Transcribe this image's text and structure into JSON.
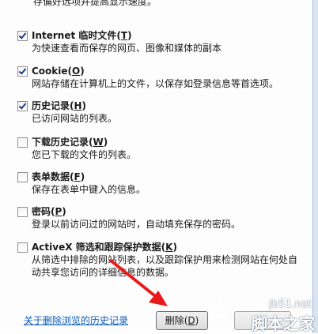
{
  "top_text": "存偏好选项并提高显示速度。",
  "options": [
    {
      "checked": true,
      "title": "Internet 临时文件",
      "hotkey": "T",
      "desc": "为快速查看而保存的网页、图像和媒体的副本"
    },
    {
      "checked": true,
      "title": "Cookie",
      "hotkey": "O",
      "desc": "网站存储在计算机上的文件，以保存如登录信息等首选项。"
    },
    {
      "checked": true,
      "title": "历史记录",
      "hotkey": "H",
      "desc": "已访问网站的列表。"
    },
    {
      "checked": false,
      "title": "下载历史记录",
      "hotkey": "W",
      "desc": "您已下载的文件的列表。"
    },
    {
      "checked": false,
      "title": "表单数据",
      "hotkey": "F",
      "desc": "保存在表单中键入的信息。"
    },
    {
      "checked": false,
      "title": "密码",
      "hotkey": "P",
      "desc": "登录以前访问过的网站时，自动填充保存的密码。"
    },
    {
      "checked": false,
      "title": "ActiveX 筛选和跟踪保护数据",
      "hotkey": "K",
      "desc": "从筛选中排除的网站列表，以及跟踪保护用来检测网站在何处自动共享您访问的详细信息的数据。"
    }
  ],
  "footer": {
    "link_text": "关于删除浏览的历史记录",
    "delete_button": "删除",
    "delete_hotkey": "D"
  },
  "watermark": {
    "domain": "jb51.net",
    "name": "脚本之家"
  },
  "colors": {
    "link": "#0b5bb7",
    "arrow": "#e81b1b",
    "check": "#1d3b8a"
  }
}
